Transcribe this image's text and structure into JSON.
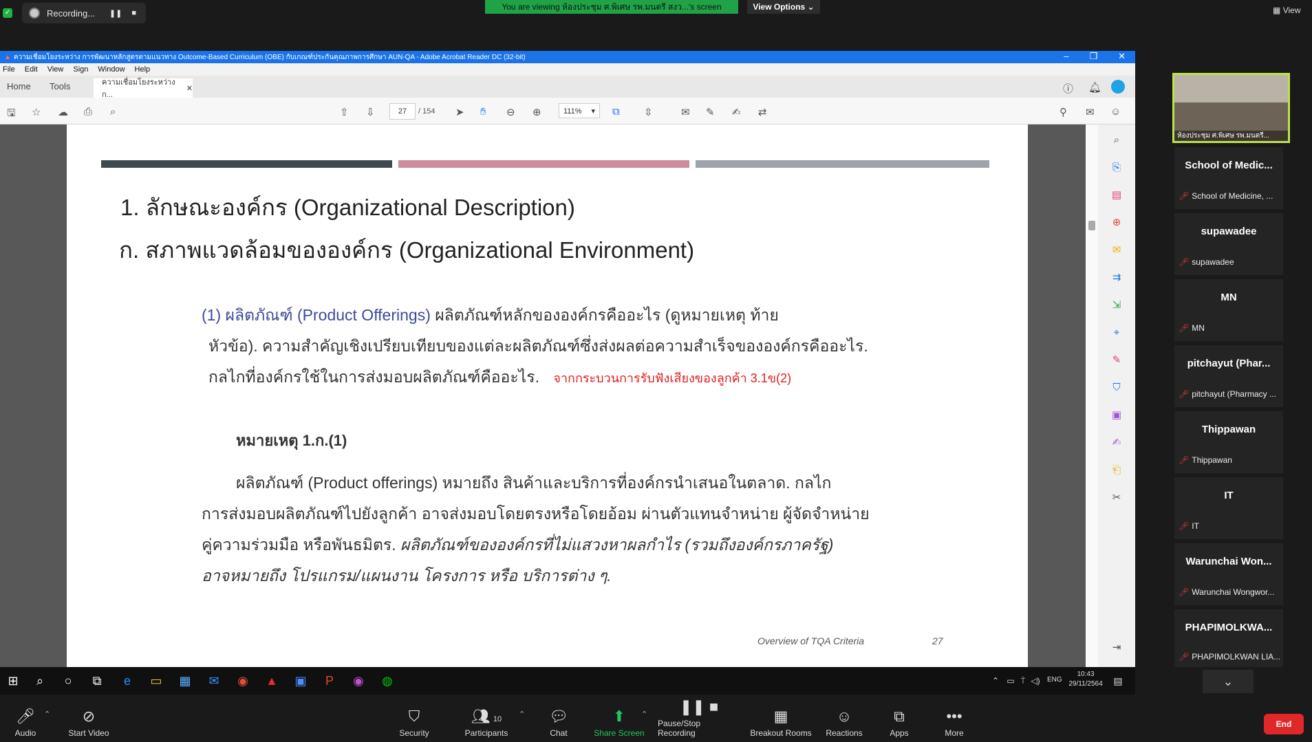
{
  "zoom_top": {
    "recording_label": "Recording...",
    "viewing_banner": "You are viewing ห้องประชุม ศ.พิเศษ รพ.มนตรี สงว...'s screen",
    "view_options": "View Options",
    "view_label": "View"
  },
  "acrobat": {
    "window_title": "ความเชื่อมโยงระหว่าง การพัฒนาหลักสูตรตามแนวทาง Outcome-Based Curriculum (OBE) กับเกณฑ์ประกันคุณภาพการศึกษา AUN-QA - Adobe Acrobat Reader DC (32-bit)",
    "menu": [
      "File",
      "Edit",
      "View",
      "Sign",
      "Window",
      "Help"
    ],
    "tabs": {
      "home": "Home",
      "tools": "Tools",
      "doc": "ความเชื่อมโยงระหว่าง ก..."
    },
    "page_current": "27",
    "page_total": "/ 154",
    "zoom": "111%"
  },
  "document": {
    "heading1": "1. ลักษณะองค์กร (Organizational Description)",
    "heading2": "ก. สภาพแวดล้อมขององค์กร (Organizational Environment)",
    "item_label": "(1)  ผลิตภัณฑ์ (Product Offerings)",
    "para1_a": " ผลิตภัณฑ์หลักขององค์กรคืออะไร (ดูหมายเหตุ ท้าย",
    "para1_b": "หัวข้อ). ความสำคัญเชิงเปรียบเทียบของแต่ละผลิตภัณฑ์ซึ่งส่งผลต่อความสำเร็จขององค์กรคืออะไร.",
    "para1_c": "กลไกที่องค์กรใช้ในการส่งมอบผลิตภัณฑ์คืออะไร.",
    "red_note": "จากกระบวนการรับฟังเสียงของลูกค้า 3.1ข(2)",
    "note_title": "หมายเหตุ 1.ก.(1)",
    "note_l1": "ผลิตภัณฑ์ (Product offerings) หมายถึง สินค้าและบริการที่องค์กรนำเสนอในตลาด. กลไก",
    "note_l2": "การส่งมอบผลิตภัณฑ์ไปยังลูกค้า อาจส่งมอบโดยตรงหรือโดยอ้อม ผ่านตัวแทนจำหน่าย ผู้จัดจำหน่าย",
    "note_l3a": "คู่ความร่วมมือ หรือพันธมิตร. ",
    "note_l3b": "ผลิตภัณฑ์ขององค์กรที่ไม่แสวงหาผลกำไร (รวมถึงองค์กรภาครัฐ)",
    "note_l4": "อาจหมายถึง โปรแกรม/แผนงาน โครงการ หรือ บริการต่าง ๆ.",
    "footer_left": "Overview of TQA Criteria",
    "footer_page": "27",
    "bar_colors": [
      "#3f4a50",
      "#cc8c9c",
      "#9ea2aa"
    ]
  },
  "taskbar": {
    "lang": "ENG",
    "time": "10:43",
    "date": "29/11/2564"
  },
  "gallery": {
    "self_caption": "ห้องประชุม ศ.พิเศษ รพ.มนตรี...",
    "participants": [
      {
        "name": "School of Medic...",
        "sub": "School of Medicine, ..."
      },
      {
        "name": "supawadee",
        "sub": "supawadee"
      },
      {
        "name": "MN",
        "sub": "MN"
      },
      {
        "name": "pitchayut (Phar...",
        "sub": "pitchayut (Pharmacy ..."
      },
      {
        "name": "Thippawan",
        "sub": "Thippawan"
      },
      {
        "name": "IT",
        "sub": "IT"
      },
      {
        "name": "Warunchai Won...",
        "sub": "Warunchai Wongwor..."
      },
      {
        "name": "PHAPIMOLKWA...",
        "sub": "PHAPIMOLKWAN LIA..."
      }
    ]
  },
  "controls": {
    "audio": "Audio",
    "start_video": "Start Video",
    "security": "Security",
    "participants": "Participants",
    "participants_count": "10",
    "chat": "Chat",
    "share_screen": "Share Screen",
    "pause_stop": "Pause/Stop Recording",
    "breakout": "Breakout Rooms",
    "reactions": "Reactions",
    "apps": "Apps",
    "more": "More",
    "end": "End",
    "share_color": "#22c55e",
    "end_color": "#e02828"
  }
}
